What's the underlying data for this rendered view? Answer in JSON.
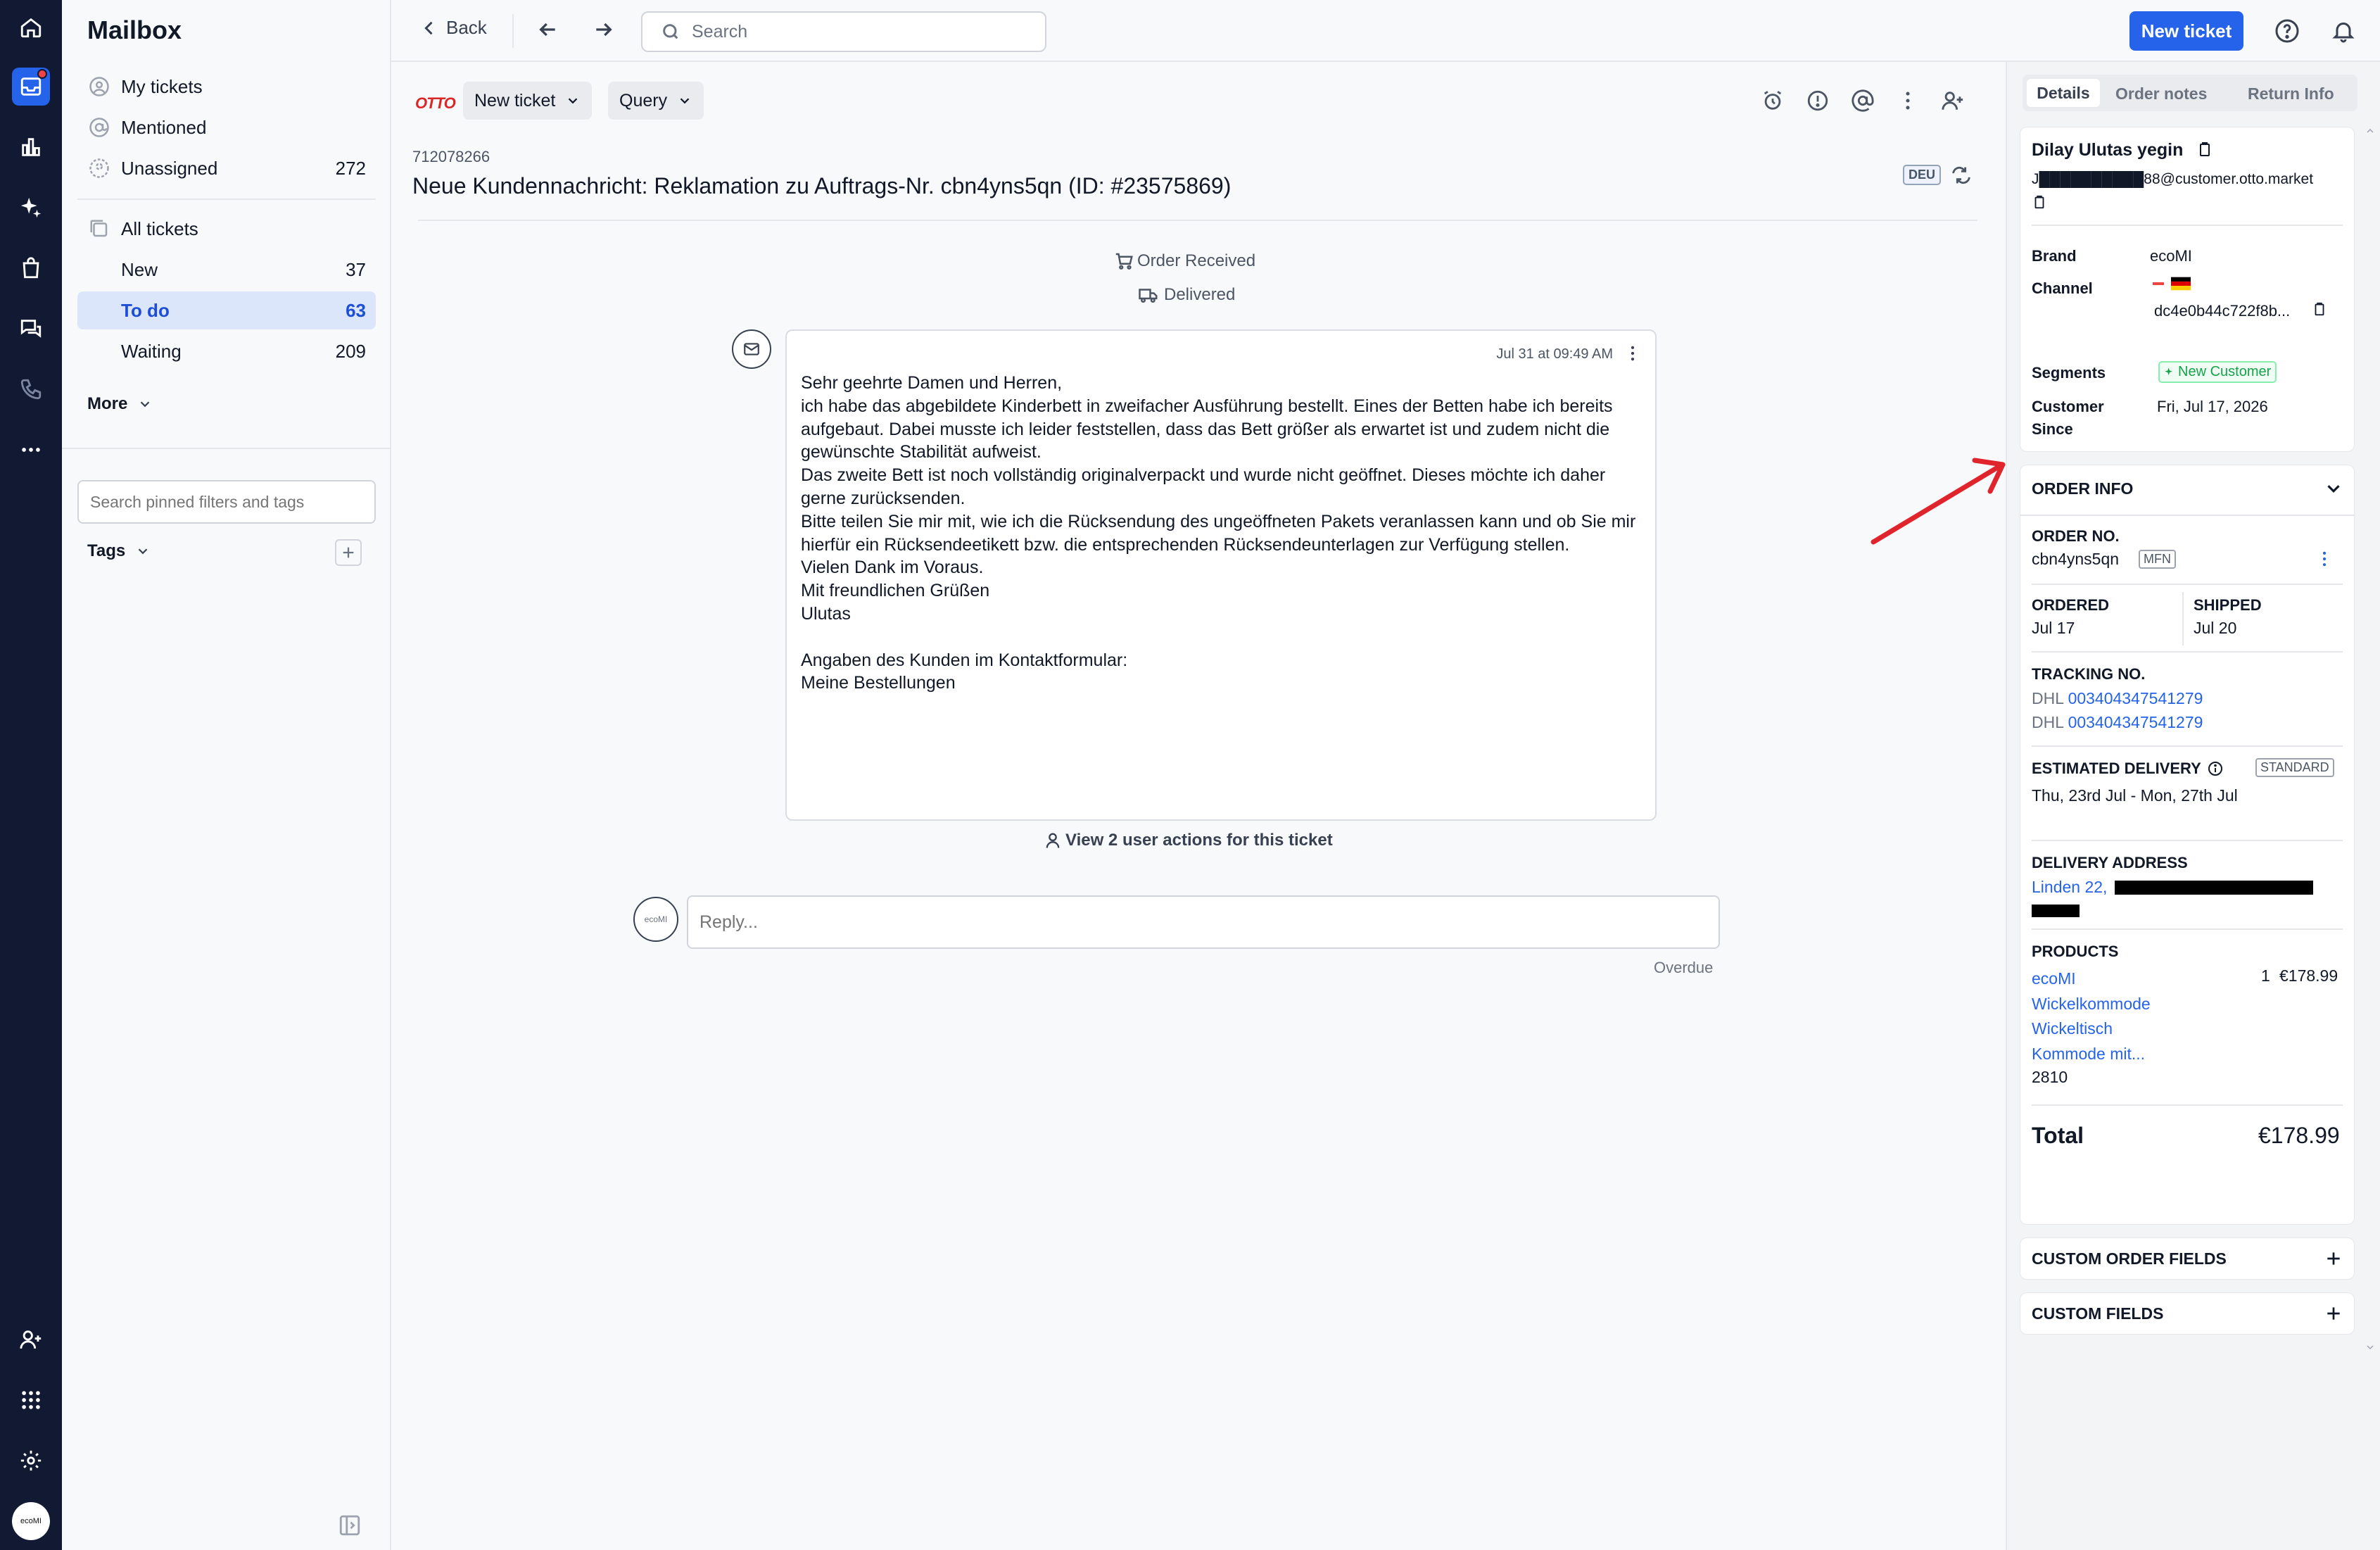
{
  "app": {
    "title": "Mailbox"
  },
  "sidebar": {
    "items": [
      {
        "label": "My tickets",
        "count": ""
      },
      {
        "label": "Mentioned",
        "count": ""
      },
      {
        "label": "Unassigned",
        "count": "272"
      }
    ],
    "all_tickets": {
      "label": "All tickets"
    },
    "sub_items": [
      {
        "label": "New",
        "count": "37"
      },
      {
        "label": "To do",
        "count": "63"
      },
      {
        "label": "Waiting",
        "count": "209"
      }
    ],
    "more_label": "More",
    "filter_placeholder": "Search pinned filters and tags",
    "tags_label": "Tags"
  },
  "topbar": {
    "back_label": "Back",
    "search_placeholder": "Search",
    "new_ticket_label": "New ticket"
  },
  "ticket": {
    "source_logo": "OTTO",
    "type_chip": "New ticket",
    "category_chip": "Query",
    "id": "712078266",
    "subject": "Neue Kundennachricht: Reklamation zu Auftrags-Nr. cbn4yns5qn (ID: #23575869)",
    "language_badge": "DEU",
    "events": [
      "Order Received",
      "Delivered"
    ],
    "message": {
      "timestamp": "Jul 31 at 09:49 AM",
      "body": "Sehr geehrte Damen und Herren,\nich habe das abgebildete Kinderbett in zweifacher Ausführung bestellt. Eines der Betten habe ich bereits aufgebaut. Dabei musste ich leider feststellen, dass das Bett größer als erwartet ist und zudem nicht die gewünschte Stabilität aufweist.\nDas zweite Bett ist noch vollständig originalverpackt und wurde nicht geöffnet. Dieses möchte ich daher gerne zurücksenden.\nBitte teilen Sie mir mit, wie ich die Rücksendung des ungeöffneten Pakets veranlassen kann und ob Sie mir hierfür ein Rücksendeetikett bzw. die entsprechenden Rücksendeunterlagen zur Verfügung stellen.\nVielen Dank im Voraus.\nMit freundlichen Grüßen\nUlutas\n\nAngaben des Kunden im Kontaktformular:\nMeine Bestellungen"
    },
    "user_actions_label": "View 2 user actions for this ticket",
    "reply_placeholder": "Reply...",
    "reply_avatar": "ecoMI",
    "overdue_label": "Overdue"
  },
  "right_panel": {
    "tabs": [
      "Details",
      "Order notes",
      "Return Info"
    ],
    "customer": {
      "name": "Dilay Ulutas yegin",
      "email_visible": "J██████████88@customer.otto.market",
      "brand_label": "Brand",
      "brand_value": "ecoMI",
      "channel_label": "Channel",
      "channel_value": "dc4e0b44c722f8b...",
      "segments_label": "Segments",
      "segment_value": "New Customer",
      "since_label_1": "Customer",
      "since_label_2": "Since",
      "since_value": "Fri, Jul 17, 2026"
    },
    "order": {
      "header": "ORDER INFO",
      "order_no_label": "ORDER NO.",
      "order_no": "cbn4yns5qn",
      "order_tag": "MFN",
      "ordered_label": "ORDERED",
      "ordered": "Jul 17",
      "shipped_label": "SHIPPED",
      "shipped": "Jul 20",
      "tracking_label": "TRACKING NO.",
      "tracking": [
        {
          "carrier": "DHL",
          "number": "003404347541279"
        },
        {
          "carrier": "DHL",
          "number": "003404347541279"
        }
      ],
      "est_label": "ESTIMATED DELIVERY",
      "est_tag": "STANDARD",
      "est_value": "Thu, 23rd Jul - Mon, 27th Jul",
      "address_label": "DELIVERY ADDRESS",
      "address_visible": "Linden 22,",
      "products_label": "PRODUCTS",
      "product": {
        "name": "ecoMI Wickelkommode Wickeltisch Kommode mit...",
        "sku": "2810",
        "qty": "1",
        "price": "€178.99"
      },
      "total_label": "Total",
      "total": "€178.99"
    },
    "custom_order_fields": "CUSTOM ORDER FIELDS",
    "custom_fields": "CUSTOM FIELDS"
  },
  "colors": {
    "accent": "#2563eb",
    "rail": "#121a33",
    "annotation_arrow": "#e0242b",
    "segment_green": "#16a34a"
  }
}
